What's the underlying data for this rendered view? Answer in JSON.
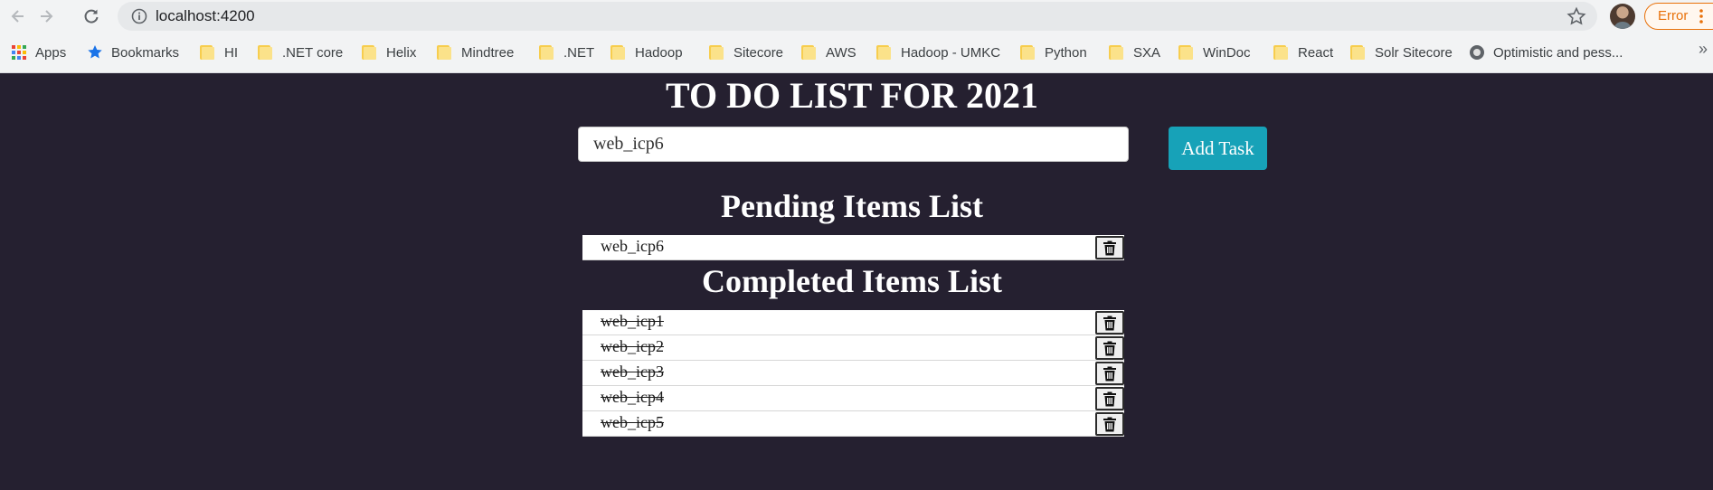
{
  "browser": {
    "url": "localhost:4200",
    "error_label": "Error",
    "bookmarks": [
      {
        "label": "Apps",
        "icon": "apps-grid-icon"
      },
      {
        "label": "Bookmarks",
        "icon": "star-icon"
      },
      {
        "label": "HI",
        "icon": "folder-icon"
      },
      {
        "label": ".NET core",
        "icon": "folder-icon"
      },
      {
        "label": "Helix",
        "icon": "folder-icon"
      },
      {
        "label": "Mindtree",
        "icon": "folder-icon"
      },
      {
        "label": ".NET",
        "icon": "folder-icon"
      },
      {
        "label": "Hadoop",
        "icon": "folder-icon"
      },
      {
        "label": "Sitecore",
        "icon": "folder-icon"
      },
      {
        "label": "AWS",
        "icon": "folder-icon"
      },
      {
        "label": "Hadoop - UMKC",
        "icon": "folder-icon"
      },
      {
        "label": "Python",
        "icon": "folder-icon"
      },
      {
        "label": "SXA",
        "icon": "folder-icon"
      },
      {
        "label": "WinDoc",
        "icon": "folder-icon"
      },
      {
        "label": "React",
        "icon": "folder-icon"
      },
      {
        "label": "Solr Sitecore",
        "icon": "folder-icon"
      },
      {
        "label": "Optimistic and pess...",
        "icon": "globe-icon"
      }
    ],
    "more_bookmarks": "»"
  },
  "app": {
    "title": "TO DO LIST FOR 2021",
    "input_value": "web_icp6",
    "add_button": "Add Task",
    "pending_title": "Pending Items List",
    "pending_items": [
      "web_icp6"
    ],
    "completed_title": "Completed Items List",
    "completed_items": [
      "web_icp1",
      "web_icp2",
      "web_icp3",
      "web_icp4",
      "web_icp5"
    ]
  },
  "colors": {
    "background": "#252030",
    "accent": "#17a2b8",
    "error": "#e8710a"
  }
}
